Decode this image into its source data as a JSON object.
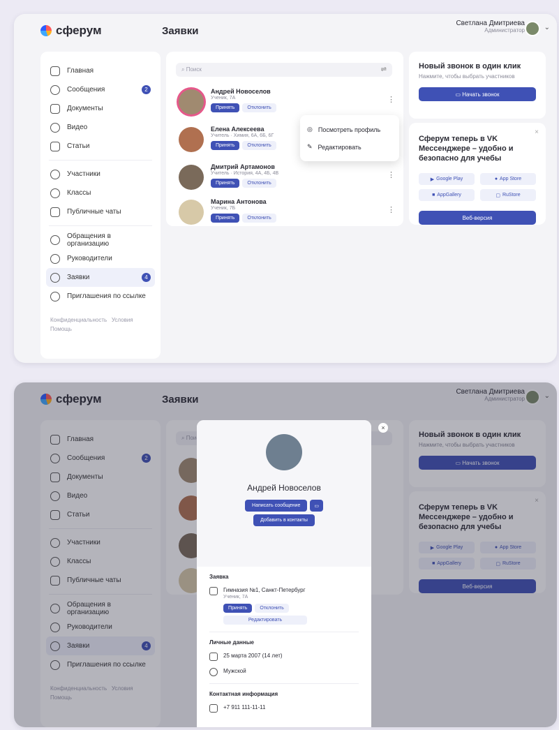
{
  "app": {
    "logo_text": "сферум",
    "page_title": "Заявки",
    "user_name": "Светлана Дмитриева",
    "user_role": "Администратор"
  },
  "sidebar": {
    "items": [
      {
        "label": "Главная",
        "icon": "grid-icon"
      },
      {
        "label": "Сообщения",
        "icon": "chat-icon",
        "badge": "2"
      },
      {
        "label": "Документы",
        "icon": "document-icon"
      },
      {
        "label": "Видео",
        "icon": "play-icon"
      },
      {
        "label": "Статьи",
        "icon": "article-icon"
      },
      {
        "label": "Участники",
        "icon": "users-icon"
      },
      {
        "label": "Классы",
        "icon": "class-icon"
      },
      {
        "label": "Публичные чаты",
        "icon": "public-chat-icon"
      },
      {
        "label": "Обращения в организацию",
        "icon": "appeal-icon"
      },
      {
        "label": "Руководители",
        "icon": "leader-icon"
      },
      {
        "label": "Заявки",
        "icon": "add-user-icon",
        "badge": "4",
        "active": true
      },
      {
        "label": "Приглашения по ссылке",
        "icon": "link-icon"
      }
    ],
    "footer": {
      "privacy": "Конфиденциальность",
      "terms": "Условия",
      "help": "Помощь"
    }
  },
  "search": {
    "placeholder": "Поиск"
  },
  "requests": [
    {
      "name": "Андрей Новоселов",
      "sub": "Ученик, 7А"
    },
    {
      "name": "Елена Алексеева",
      "sub": "Учитель · Химия, 6А, 6Б, 6Г"
    },
    {
      "name": "Дмитрий Артамонов",
      "sub": "Учитель · История, 4А, 4Б, 4В"
    },
    {
      "name": "Марина Антонова",
      "sub": "Ученик, 7Б"
    }
  ],
  "buttons": {
    "accept": "Принять",
    "reject": "Отклонить"
  },
  "context_menu": {
    "view_profile": "Посмотреть профиль",
    "edit": "Редактировать"
  },
  "call_card": {
    "title": "Новый звонок в один клик",
    "subtitle": "Нажмите, чтобы выбрать участников",
    "button": "Начать звонок"
  },
  "vk_card": {
    "title": "Сферум теперь в VK Мессенджере – удобно и безопасно для учебы",
    "stores": [
      "Google Play",
      "App Store",
      "AppGallery",
      "RuStore"
    ],
    "button": "Веб-версия"
  },
  "modal": {
    "name": "Андрей Новоселов",
    "write_button": "Написать сообщение",
    "add_contact_button": "Добавить в контакты",
    "request_section": "Заявка",
    "school": "Гимназия №1, Санкт-Петербург",
    "school_sub": "Ученик, 7А",
    "accept": "Принять",
    "reject": "Отклонить",
    "edit": "Редактировать",
    "personal_section": "Личные данные",
    "birthday": "25 марта 2007 (14 лет)",
    "gender": "Мужской",
    "contact_section": "Контактная информация",
    "phone": "+7 911 111-11-11"
  }
}
